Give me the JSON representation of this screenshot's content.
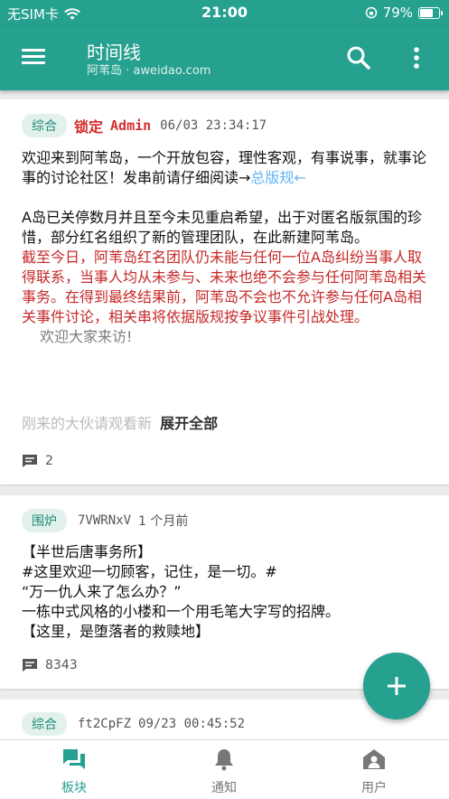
{
  "status_bar": {
    "carrier": "无SIM卡",
    "time": "21:00",
    "battery": "79%",
    "battery_level": 0.79
  },
  "app_bar": {
    "title": "时间线",
    "subtitle": "阿苇岛 · aweidao.com"
  },
  "posts": [
    {
      "tag": "综合",
      "lock": "锁定",
      "author": "Admin",
      "timestamp": "06/03 23:34:17",
      "para1": "欢迎来到阿苇岛，一个开放包容，理性客观，有事说事，就事论事的讨论社区！发串前请仔细阅读→",
      "link": "总版规←",
      "para2": "A岛已关停数月并且至今未见重启希望，出于对匿名版氛围的珍惜，部分红名组织了新的管理团队，在此新建阿苇岛。",
      "para3": "截至今日，阿苇岛红名团队仍未能与任何一位A岛纠纷当事人取得联系，当事人均从未参与、未来也绝不会参与任何阿苇岛相关事务。在得到最终结果前，阿苇岛不会也不允许参与任何A岛相关事件讨论，相关串将依据版规按争议事件引战处理。",
      "para4": "欢迎大家来访!",
      "para5": "刚来的大伙请观看新",
      "expand": "展开全部",
      "replies": "2"
    },
    {
      "tag": "围炉",
      "author": "7VWRNxV",
      "timestamp": "1 个月前",
      "lines": [
        "【半世后唐事务所】",
        "#这里欢迎一切顾客，记住，是一切。#",
        "“万一仇人来了怎么办？”",
        "一栋中式风格的小楼和一个用毛笔大字写的招牌。",
        "【这里，是堕落者的救赎地】"
      ],
      "replies": "8343"
    },
    {
      "tag": "综合",
      "author": "ft2CpFZ",
      "timestamp": "09/23 00:45:52"
    }
  ],
  "bottom_nav": [
    {
      "label": "板块",
      "icon": "forum-icon"
    },
    {
      "label": "通知",
      "icon": "bell-icon"
    },
    {
      "label": "用户",
      "icon": "user-icon"
    }
  ],
  "colors": {
    "primary": "#26a08f",
    "lock_red": "#d32f2f",
    "notice_red": "#c62828",
    "link_blue": "#64b5f6"
  }
}
